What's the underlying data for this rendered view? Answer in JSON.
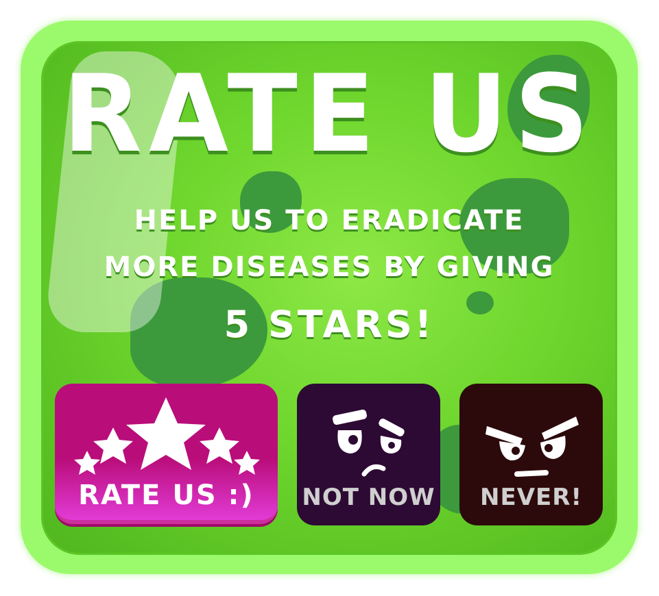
{
  "dialog": {
    "title": "RATE US",
    "message_line1": "HELP US TO ERADICATE",
    "message_line2": "MORE DISEASES BY GIVING",
    "message_line3": "5 STARS!"
  },
  "buttons": {
    "rate_label": "RATE US :)",
    "not_now_label": "NOT NOW",
    "never_label": "NEVER!"
  },
  "colors": {
    "panel_border": "#9bfa6c",
    "panel_fill": "#6ed62d",
    "rate_button": "#b90d7a",
    "not_now_button": "#2d0a33",
    "never_button": "#2c0a0b"
  },
  "icons": {
    "rate": "five-stars-icon",
    "not_now": "sad-face-icon",
    "never": "angry-face-icon"
  }
}
